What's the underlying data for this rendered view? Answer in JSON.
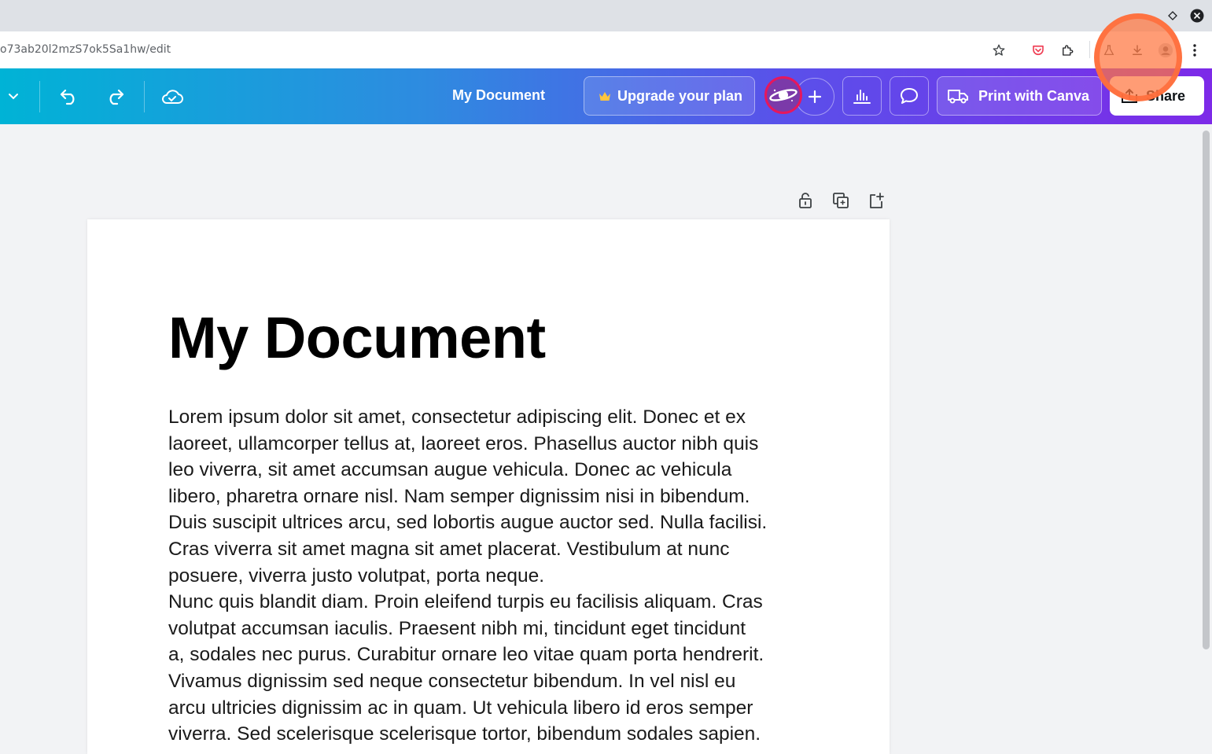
{
  "browser": {
    "url": "o73ab20l2mzS7ok5Sa1hw/edit"
  },
  "topbar": {
    "document_title": "My Document",
    "upgrade_label": "Upgrade your plan",
    "print_label": "Print with Canva",
    "share_label": "Share"
  },
  "document": {
    "heading": "My Document",
    "body_lines": [
      "Lorem ipsum dolor sit amet, consectetur adipiscing elit. Donec et ex",
      "laoreet, ullamcorper tellus at, laoreet eros. Phasellus auctor nibh quis",
      "leo viverra, sit amet accumsan augue vehicula. Donec ac vehicula",
      "libero, pharetra ornare nisl. Nam semper dignissim nisi in bibendum.",
      "Duis suscipit ultrices arcu, sed lobortis augue auctor sed. Nulla facilisi.",
      "Cras viverra sit amet magna sit amet placerat. Vestibulum at nunc",
      "posuere, viverra justo volutpat, porta neque.",
      "Nunc quis blandit diam. Proin eleifend turpis eu facilisis aliquam. Cras",
      "volutpat accumsan iaculis. Praesent nibh mi, tincidunt eget tincidunt",
      "a, sodales nec purus. Curabitur ornare leo vitae quam porta hendrerit.",
      "Vivamus dignissim sed neque consectetur bibendum. In vel nisl eu",
      "arcu ultricies dignissim ac in quam. Ut vehicula libero id eros semper",
      "viverra. Sed scelerisque scelerisque tortor, bibendum sodales sapien."
    ]
  },
  "colors": {
    "topbar_gradient_start": "#00b3d6",
    "topbar_gradient_end": "#7d2ae8",
    "highlight": "#ff7640"
  },
  "icons": [
    "chevron-down-icon",
    "undo-icon",
    "redo-icon",
    "cloud-saved-icon",
    "crown-icon",
    "plus-icon",
    "analytics-icon",
    "comment-icon",
    "truck-icon",
    "lock-icon",
    "duplicate-icon",
    "add-page-icon",
    "star-icon",
    "pocket-icon",
    "extensions-icon",
    "labs-icon",
    "download-icon",
    "profile-icon",
    "more-icon"
  ]
}
